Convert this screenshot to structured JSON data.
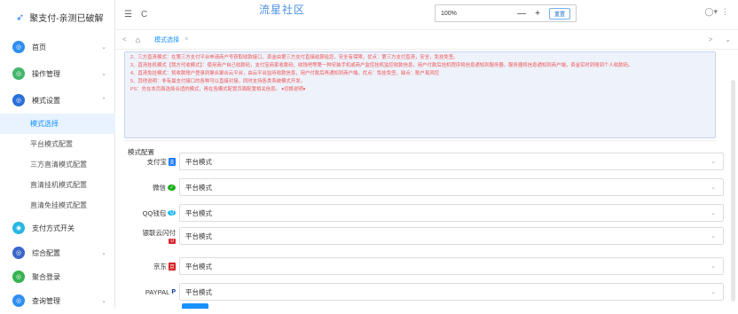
{
  "brand": {
    "title": "聚支付-亲测已破解"
  },
  "sidebar": {
    "items": [
      {
        "label": "首页",
        "icon_color": "#2f8ef0",
        "icon": "home-icon",
        "glyph": "◎",
        "chev": "⌄"
      },
      {
        "label": "操作管理",
        "icon_color": "#43b66b",
        "icon": "operation-icon",
        "glyph": "◎",
        "chev": "⌄"
      },
      {
        "label": "模式设置",
        "icon_color": "#2a6fd8",
        "icon": "mode-icon",
        "glyph": "◎",
        "chev": "⌃"
      },
      {
        "label": "支付方式开关",
        "icon_color": "#28b6e0",
        "icon": "switch-icon",
        "glyph": "◉",
        "chev": ""
      },
      {
        "label": "综合配置",
        "icon_color": "#3c67c9",
        "icon": "config-icon",
        "glyph": "◎",
        "chev": "⌄"
      },
      {
        "label": "聚合登录",
        "icon_color": "#36b24f",
        "icon": "login-icon",
        "glyph": "◎",
        "chev": ""
      },
      {
        "label": "查询管理",
        "icon_color": "#2f8ef0",
        "icon": "query-icon",
        "glyph": "◎",
        "chev": "⌄"
      }
    ],
    "sub_items": [
      {
        "label": "模式选择"
      },
      {
        "label": "平台模式配置"
      },
      {
        "label": "三方直清模式配置"
      },
      {
        "label": "直清挂机模式配置"
      },
      {
        "label": "直清免挂模式配置"
      }
    ]
  },
  "topbar": {
    "menu_glyph": "☰",
    "refresh_glyph": "C",
    "watermark": "流星社区",
    "zoom": "100%",
    "zoom_minus": "—",
    "zoom_plus": "+",
    "zoom_reset": "重置",
    "avatar_glyph": "◯▾",
    "more_glyph": "⋮"
  },
  "tabs": {
    "prev": "<",
    "home": "⌂",
    "active": "模式选择",
    "close": "×",
    "next": ">",
    "dropdown": "⌄"
  },
  "notice": {
    "lines": [
      "2、三方直清模式：在第三方支付平台申请商户号获取收款接口，资金由第三方支付直接结算给您，安全有保障，优点：第三方支付直清，安全，免挂免签。",
      "3、直清挂机模式【我方代收模式】：使用商户自己收款码，支付宝商家收款码、收钱吧等第一种安装手机或商户监控挂机监控收款信息，用户付款后挂机程序将信息通知到服务器，服务器将信息通知到商户端，资金实时到账到个人收款码。",
      "4、直清免挂模式：将收款账户登录到聚合聚合云平台，由云平台监听收款信息，用户付款后再通知到商户端，优点：免挂免签，缺点：账户易风控",
      "5、其他说明：非有最支付接口的各种可以直接对接，同时支持各类系统模式开发。",
      "PS：先在本页面选择合适的模式，再在各模式配置页面配置相关信息。 ▾切换说明▾"
    ]
  },
  "form": {
    "section_title": "模式配置",
    "rows": [
      {
        "label": "支付宝",
        "badge": "支",
        "badge_color": "#1677ff",
        "value": "平台模式"
      },
      {
        "label": "微信",
        "badge": "✓",
        "badge_color": "#1aad19",
        "value": "平台模式"
      },
      {
        "label": "QQ钱包",
        "badge": "Q",
        "badge_color": "#12b7f5",
        "value": "平台模式"
      },
      {
        "label": "银联云闪付",
        "badge": "U",
        "badge_color": "#d8262f",
        "value": "平台模式"
      },
      {
        "label": "京东",
        "badge": "京",
        "badge_color": "#d71c1e",
        "value": "平台模式"
      },
      {
        "label": "PAYPAL",
        "badge": "P",
        "badge_color": "#003087",
        "value": "平台模式"
      }
    ],
    "arrow": "⌄"
  }
}
